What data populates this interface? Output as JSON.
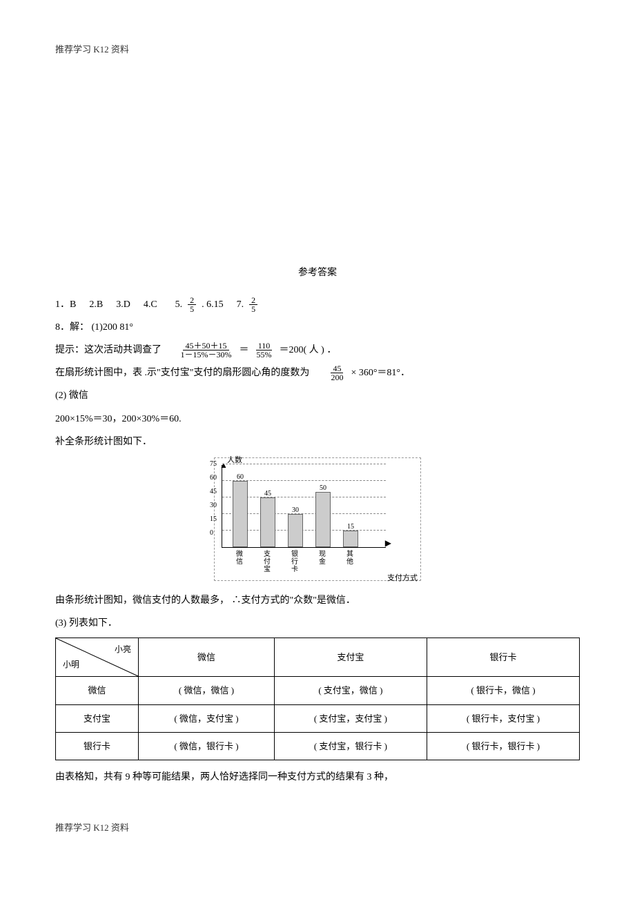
{
  "header": "推荐学习   K12 资料",
  "footer": "推荐学习   K12 资料",
  "title": "参考答案",
  "short_answers": {
    "a1": "1．B",
    "a2": "2.B",
    "a3": "3.D",
    "a4": "4.C",
    "a5_pre": "5.",
    "a5_num": "2",
    "a5_den": "5",
    "a6": ". 6.15",
    "a7_pre": "7.",
    "a7_num": "2",
    "a7_den": "5"
  },
  "q8": {
    "line1": "8．解：  (1)200      81°",
    "hint_pre": "提示：这次活动共调查了",
    "frac1_num": "45＋50＋15",
    "frac1_den": "1－15%－30%",
    "eq": "＝",
    "frac2_num": "110",
    "frac2_den": "55%",
    "tail": "＝200( 人 ) ．",
    "sector_pre": "在扇形统计图中，表   .示\"支付宝\"支付的扇形圆心角的度数为",
    "sector_num": "45",
    "sector_den": "200",
    "sector_tail": "× 360°＝81°．",
    "part2_a": "(2) 微信",
    "part2_b": "200×15%＝30，200×30%＝60.",
    "part2_c": "补全条形统计图如下．",
    "conclusion": "由条形统计图知，微信支付的人数最多， ∴支付方式的\"众数\"是微信．",
    "part3": "(3) 列表如下．",
    "summary": "由表格知，共有     9 种等可能结果，两人恰好选择同一种支付方式的结果有           3 种，"
  },
  "chart_data": {
    "type": "bar",
    "ylabel": "人数",
    "xlabel": "支付方式",
    "categories": [
      "微信",
      "支付宝",
      "银行卡",
      "现金",
      "其他"
    ],
    "values": [
      60,
      45,
      30,
      50,
      15
    ],
    "y_ticks": [
      0,
      15,
      30,
      45,
      60,
      75
    ],
    "ylim": [
      0,
      75
    ]
  },
  "table": {
    "top": "小亮",
    "left": "小明",
    "cols": [
      "微信",
      "支付宝",
      "银行卡"
    ],
    "rows": [
      "微信",
      "支付宝",
      "银行卡"
    ],
    "cells": [
      [
        "( 微信，微信  )",
        "( 支付宝，微信  )",
        "( 银行卡，微信  )"
      ],
      [
        "( 微信，支付宝  )",
        "( 支付宝，支付宝  )",
        "( 银行卡，支付宝  )"
      ],
      [
        "( 微信，银行卡  )",
        "( 支付宝，银行卡  )",
        "( 银行卡，银行卡  )"
      ]
    ]
  }
}
